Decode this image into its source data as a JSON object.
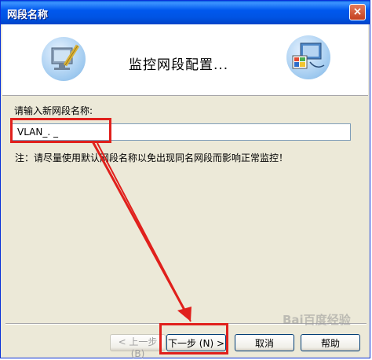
{
  "window": {
    "title": "网段名称",
    "close_label": "×"
  },
  "header": {
    "title": "监控网段配置...",
    "left_icon": "edit-monitor-icon",
    "right_icon": "network-monitor-icon"
  },
  "form": {
    "label": "请输入新网段名称:",
    "input_value": "VLAN_. _",
    "note": "注：请尽量使用默认网段名称以免出现同名网段而影响正常监控！"
  },
  "buttons": {
    "prev": "< 上一步 (B)",
    "next": "下一步 (N) >",
    "cancel": "取消",
    "help": "帮助"
  },
  "watermark": "Bai百度经验",
  "colors": {
    "titlebar": "#0054e3",
    "annotation": "#e0201c",
    "dialog_bg": "#ece9d8"
  }
}
